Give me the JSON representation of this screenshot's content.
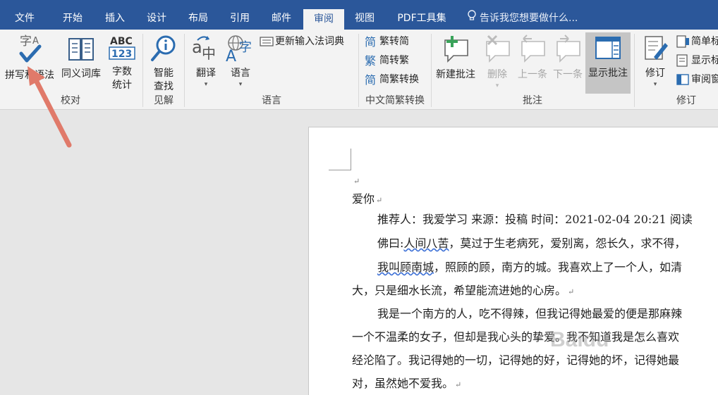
{
  "tabs": [
    {
      "label": "文件"
    },
    {
      "label": "开始"
    },
    {
      "label": "插入"
    },
    {
      "label": "设计"
    },
    {
      "label": "布局"
    },
    {
      "label": "引用"
    },
    {
      "label": "邮件"
    },
    {
      "label": "审阅"
    },
    {
      "label": "视图"
    },
    {
      "label": "PDF工具集"
    }
  ],
  "tell_me": "告诉我您想要做什么...",
  "ribbon": {
    "proofing": {
      "group_label": "校对",
      "spelling": "拼写和语法",
      "thesaurus": "同义词库",
      "wordcount_1": "字数",
      "wordcount_2": "统计",
      "wordcount_icon_text": "ABC",
      "wordcount_icon_num": "123"
    },
    "insights": {
      "group_label": "见解",
      "smart_1": "智能",
      "smart_2": "查找"
    },
    "language": {
      "group_label": "语言",
      "translate": "翻译",
      "language": "语言",
      "update_ime": "更新输入法词典"
    },
    "chinese": {
      "group_label": "中文简繁转换",
      "to_simplified": "繁转简",
      "to_traditional": "简转繁",
      "convert": "简繁转换"
    },
    "comments": {
      "group_label": "批注",
      "new": "新建批注",
      "delete": "删除",
      "previous": "上一条",
      "next": "下一条",
      "show": "显示批注"
    },
    "tracking": {
      "group_label": "修订",
      "track": "修订",
      "simple_markup": "简单标",
      "show_markup": "显示标",
      "review_pane": "审阅窗"
    }
  },
  "document": {
    "title": "爱你",
    "line1": "推荐人：我爱学习  来源：投稿  时间：2021-02-04 20:21  阅读",
    "line2a": "佛曰:",
    "line2b": "人间八苦",
    "line2c": "，莫过于生老病死，爱别离，怨长久，求不得，",
    "line3a": "我叫顾南城",
    "line3b": "，照顾的顾，南方的城。我喜欢上了一个人，如清",
    "line4": "大，只是细水长流，希望能流进她的心房。",
    "line5": "我是一个南方的人，吃不得辣，但我记得她最爱的便是那麻辣",
    "line6": "一个不温柔的女子，但却是我心头的挚爱。我不知道我是怎么喜欢",
    "line7": "经沦陷了。我记得她的一切，记得她的好，记得她的坏，记得她最",
    "line8": "对，虽然她不爱我。",
    "watermark": "Baidu"
  },
  "colors": {
    "tabbar": "#2b579a",
    "ribbon": "#f3f3f3",
    "arrow": "#e07a6a"
  }
}
